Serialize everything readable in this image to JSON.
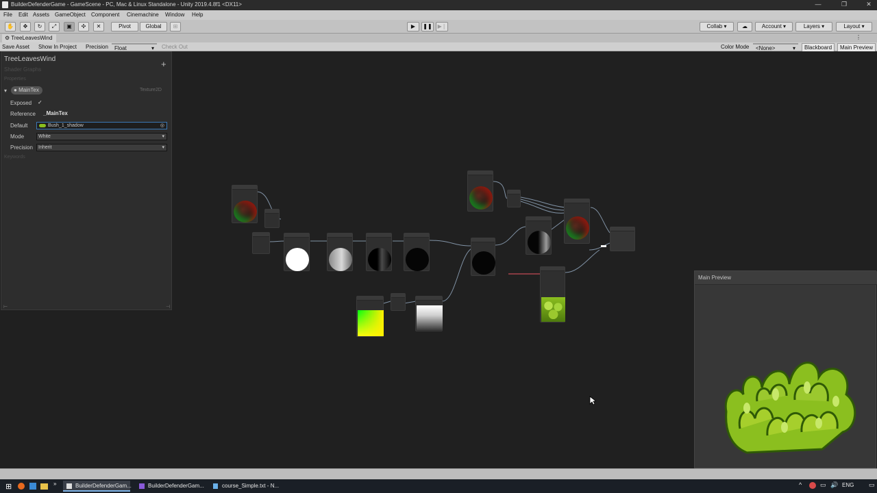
{
  "window": {
    "title": "BuilderDefenderGame - GameScene - PC, Mac & Linux Standalone - Unity 2019.4.8f1 <DX11>"
  },
  "menu": [
    "File",
    "Edit",
    "Assets",
    "GameObject",
    "Component",
    "Cinemachine",
    "Window",
    "Help"
  ],
  "toolbar": {
    "pivot": "Pivot",
    "global": "Global",
    "collab": "Collab",
    "account": "Account",
    "layers": "Layers",
    "layout": "Layout"
  },
  "tab": {
    "label": "TreeLeavesWind"
  },
  "graph_toolbar": {
    "save_asset": "Save Asset",
    "show_in_project": "Show In Project",
    "precision_label": "Precision",
    "precision_value": "Float",
    "check_out": "Check Out",
    "color_mode_label": "Color Mode",
    "color_mode_value": "<None>",
    "blackboard": "Blackboard",
    "main_preview": "Main Preview"
  },
  "blackboard": {
    "title": "TreeLeavesWind",
    "subtitle": "Shader Graphs",
    "section": "Properties",
    "property_name": "MainTex",
    "property_type": "Texture2D",
    "exposed_label": "Exposed",
    "exposed_value": "✓",
    "reference_label": "Reference",
    "reference_value": "_MainTex",
    "default_label": "Default",
    "default_value": "Bush_1_shadow",
    "mode_label": "Mode",
    "mode_value": "White",
    "precision_label": "Precision",
    "precision_value": "Inherit",
    "keywords": "Keywords"
  },
  "main_preview": {
    "title": "Main Preview"
  },
  "taskbar": {
    "items": [
      "BuilderDefenderGam...",
      "BuilderDefenderGam...",
      "course_Simple.txt - N..."
    ],
    "lang": "ENG"
  },
  "colors": {
    "canvas": "#202020",
    "panel": "#2d2d2d",
    "leaf_green": "#8bbf1f",
    "leaf_dark": "#2f5a06",
    "wire": "#9ab0c8"
  }
}
